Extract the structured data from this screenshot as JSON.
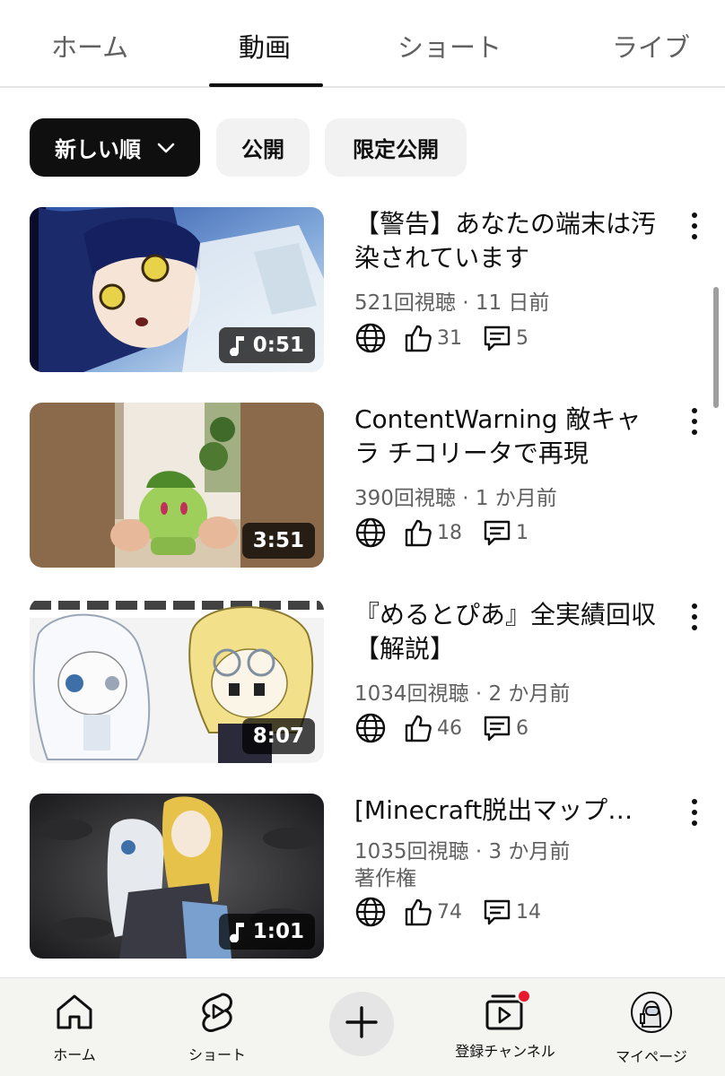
{
  "tabs": [
    {
      "label": "ホーム",
      "active": false
    },
    {
      "label": "動画",
      "active": true
    },
    {
      "label": "ショート",
      "active": false
    },
    {
      "label": "ライブ",
      "active": false
    }
  ],
  "filters": [
    {
      "label": "新しい順",
      "active": true,
      "icon": "chevron-down-icon"
    },
    {
      "label": "公開",
      "active": false
    },
    {
      "label": "限定公開",
      "active": false
    }
  ],
  "videos": [
    {
      "title_lines": [
        "【警告】あなたの端末は汚",
        "染されています"
      ],
      "meta_lines": [
        "521回視聴 · 11 日前"
      ],
      "duration": "0:51",
      "has_music_icon": true,
      "likes": "31",
      "comments": "5"
    },
    {
      "title_lines": [
        "ContentWarning 敵キャ",
        "ラ チコリータで再現"
      ],
      "meta_lines": [
        "390回視聴 · 1 か月前"
      ],
      "duration": "3:51",
      "has_music_icon": false,
      "likes": "18",
      "comments": "1"
    },
    {
      "title_lines": [
        "『めるとぴあ』全実績回収",
        "【解説】"
      ],
      "meta_lines": [
        "1034回視聴 · 2 か月前"
      ],
      "duration": "8:07",
      "has_music_icon": false,
      "likes": "46",
      "comments": "6"
    },
    {
      "title_lines": [
        "[Minecraft脱出マップ…"
      ],
      "meta_lines": [
        "1035回視聴 · 3 か月前",
        "著作権"
      ],
      "duration": "1:01",
      "has_music_icon": true,
      "likes": "74",
      "comments": "14"
    }
  ],
  "bottom_nav": [
    {
      "label": "ホーム",
      "icon": "home-icon"
    },
    {
      "label": "ショート",
      "icon": "shorts-icon"
    },
    {
      "label": "",
      "icon": "plus-icon"
    },
    {
      "label": "登録チャンネル",
      "icon": "subscriptions-icon",
      "notification_dot": true
    },
    {
      "label": "マイページ",
      "icon": "avatar-icon"
    }
  ],
  "colors": {
    "text_primary": "#0f0f0f",
    "text_secondary": "#606060",
    "chip_bg": "#f2f2f2",
    "chip_active_bg": "#0f0f0f",
    "nav_bg": "#f4f4f0",
    "notification_dot": "#e8192c"
  }
}
